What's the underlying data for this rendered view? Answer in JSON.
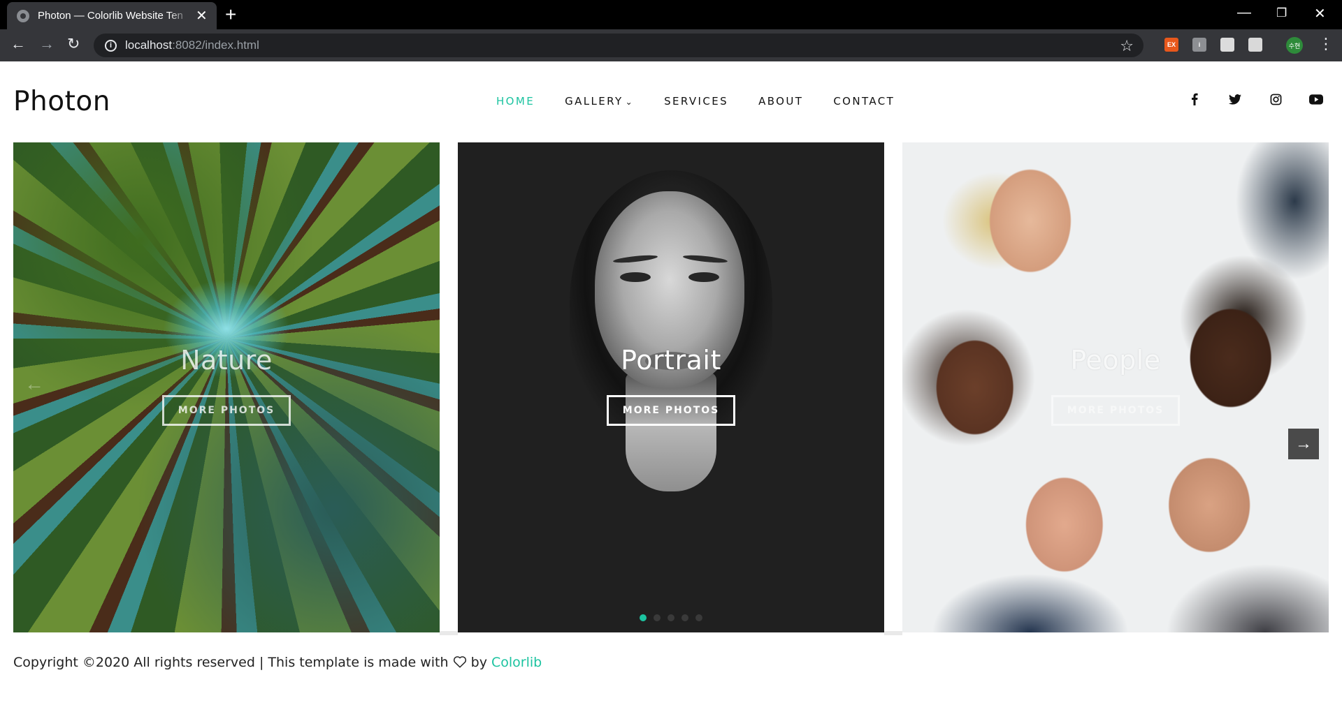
{
  "browser": {
    "tab_title": "Photon — Colorlib Website Ten",
    "url_host": "localhost",
    "url_rest": ":8082/index.html",
    "extensions": [
      "EX",
      "i",
      "",
      ""
    ],
    "profile_label": "수현"
  },
  "site": {
    "logo": "Photon",
    "menu": [
      {
        "label": "HOME",
        "active": true
      },
      {
        "label": "GALLERY"
      },
      {
        "label": "SERVICES"
      },
      {
        "label": "ABOUT"
      },
      {
        "label": "CONTACT"
      }
    ],
    "socials": [
      "facebook-icon",
      "twitter-icon",
      "instagram-icon",
      "youtube-icon"
    ]
  },
  "gallery": {
    "cards": [
      {
        "title": "Nature",
        "button": "MORE PHOTOS"
      },
      {
        "title": "Portrait",
        "button": "MORE PHOTOS"
      },
      {
        "title": "People",
        "button": "MORE PHOTOS"
      }
    ],
    "active_dot": 1,
    "dot_count": 5
  },
  "footer": {
    "text_before": "Copyright ©2020 All rights reserved | This template is made with",
    "text_by": "by",
    "link": "Colorlib"
  },
  "colors": {
    "accent": "#1cc3a0"
  }
}
